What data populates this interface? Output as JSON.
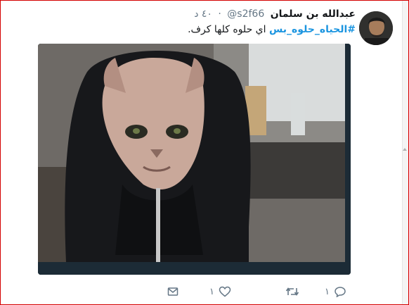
{
  "tweet": {
    "display_name": "عبدالله بن سلمان",
    "handle": "@s2f66",
    "time": "٤٠ د",
    "hashtag": "#الحياه_حلوه_بس",
    "text": "اي حلوه كلها كرف."
  },
  "media": {
    "subject": "hairless cat wearing dark hoodie"
  },
  "actions": {
    "reply_count": "١",
    "retweet_count": "",
    "like_count": "١"
  },
  "icons": {
    "reply": "reply-icon",
    "retweet": "retweet-icon",
    "like": "heart-icon",
    "message": "message-icon"
  },
  "colors": {
    "hashtag": "#1b95e0",
    "secondary_text": "#657786",
    "primary_text": "#14171a",
    "media_border": "#1c2b36",
    "frame": "#d40000"
  }
}
